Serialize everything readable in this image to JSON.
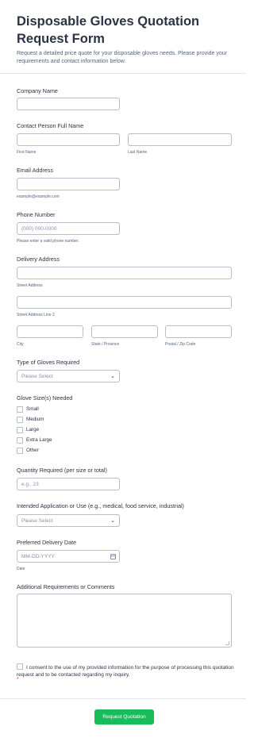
{
  "form": {
    "title": "Disposable Gloves Quotation Request Form",
    "description": "Request a detailed price quote for your disposable gloves needs. Please provide your requirements and contact information below."
  },
  "company": {
    "label": "Company Name"
  },
  "contact": {
    "label": "Contact Person Full Name",
    "first_sub": "First Name",
    "last_sub": "Last Name"
  },
  "email": {
    "label": "Email Address",
    "sub": "example@example.com"
  },
  "phone": {
    "label": "Phone Number",
    "placeholder": "(000) 000-0000",
    "sub": "Please enter a valid phone number."
  },
  "address": {
    "label": "Delivery Address",
    "street_sub": "Street Address",
    "street2_sub": "Street Address Line 2",
    "city_sub": "City",
    "state_sub": "State / Province",
    "zip_sub": "Postal / Zip Code"
  },
  "glove_type": {
    "label": "Type of Gloves Required",
    "selected": "Please Select"
  },
  "sizes": {
    "label": "Glove Size(s) Needed",
    "options": [
      "Small",
      "Medium",
      "Large",
      "Extra Large",
      "Other"
    ]
  },
  "quantity": {
    "label": "Quantity Required (per size or total)",
    "placeholder": "e.g., 23"
  },
  "application": {
    "label": "Intended Application or Use (e.g., medical, food service, industrial)",
    "selected": "Please Select"
  },
  "delivery_date": {
    "label": "Preferred Delivery Date",
    "placeholder": "MM-DD-YYYY",
    "sub": "Date"
  },
  "comments": {
    "label": "Additional Requirements or Comments"
  },
  "consent": {
    "text": "I consent to the use of my provided information for the purpose of processing this quotation request and to be contacted regarding my inquiry.",
    "required_mark": "*"
  },
  "submit": {
    "label": "Request Quotation"
  }
}
